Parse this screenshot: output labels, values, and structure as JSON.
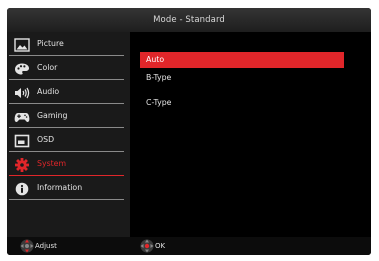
{
  "header": {
    "title": "Mode - Standard"
  },
  "sidebar": {
    "items": [
      {
        "label": "Picture",
        "icon": "picture-icon",
        "active": false
      },
      {
        "label": "Color",
        "icon": "color-palette-icon",
        "active": false
      },
      {
        "label": "Audio",
        "icon": "speaker-icon",
        "active": false
      },
      {
        "label": "Gaming",
        "icon": "gamepad-icon",
        "active": false
      },
      {
        "label": "OSD",
        "icon": "osd-window-icon",
        "active": false
      },
      {
        "label": "System",
        "icon": "gear-icon",
        "active": true
      },
      {
        "label": "Information",
        "icon": "info-icon",
        "active": false
      }
    ]
  },
  "panel": {
    "options": [
      {
        "label": "Auto",
        "selected": true
      },
      {
        "label": "B-Type",
        "selected": false
      },
      {
        "label": "C-Type",
        "selected": false
      }
    ]
  },
  "footer": {
    "adjust_label": "Adjust",
    "ok_label": "OK"
  },
  "colors": {
    "accent": "#e0262a",
    "background": "#000000",
    "sidebar": "#1a1a1a",
    "text": "#e4e4e4"
  }
}
